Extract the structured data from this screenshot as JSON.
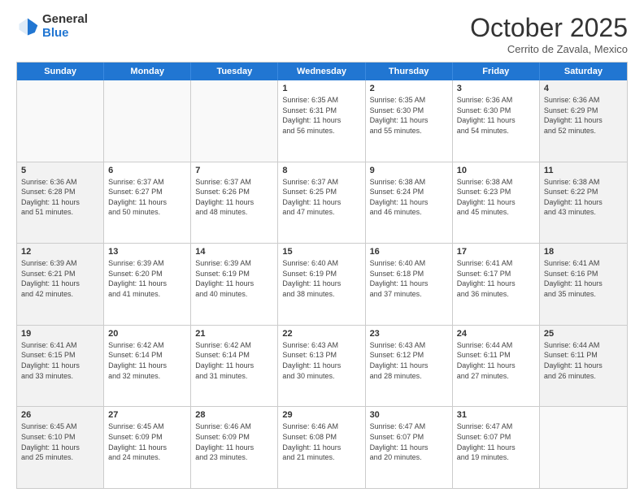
{
  "logo": {
    "general": "General",
    "blue": "Blue"
  },
  "header": {
    "month": "October 2025",
    "location": "Cerrito de Zavala, Mexico"
  },
  "weekdays": [
    "Sunday",
    "Monday",
    "Tuesday",
    "Wednesday",
    "Thursday",
    "Friday",
    "Saturday"
  ],
  "rows": [
    [
      {
        "day": "",
        "info": "",
        "shaded": false
      },
      {
        "day": "",
        "info": "",
        "shaded": false
      },
      {
        "day": "",
        "info": "",
        "shaded": false
      },
      {
        "day": "1",
        "info": "Sunrise: 6:35 AM\nSunset: 6:31 PM\nDaylight: 11 hours\nand 56 minutes.",
        "shaded": false
      },
      {
        "day": "2",
        "info": "Sunrise: 6:35 AM\nSunset: 6:30 PM\nDaylight: 11 hours\nand 55 minutes.",
        "shaded": false
      },
      {
        "day": "3",
        "info": "Sunrise: 6:36 AM\nSunset: 6:30 PM\nDaylight: 11 hours\nand 54 minutes.",
        "shaded": false
      },
      {
        "day": "4",
        "info": "Sunrise: 6:36 AM\nSunset: 6:29 PM\nDaylight: 11 hours\nand 52 minutes.",
        "shaded": true
      }
    ],
    [
      {
        "day": "5",
        "info": "Sunrise: 6:36 AM\nSunset: 6:28 PM\nDaylight: 11 hours\nand 51 minutes.",
        "shaded": true
      },
      {
        "day": "6",
        "info": "Sunrise: 6:37 AM\nSunset: 6:27 PM\nDaylight: 11 hours\nand 50 minutes.",
        "shaded": false
      },
      {
        "day": "7",
        "info": "Sunrise: 6:37 AM\nSunset: 6:26 PM\nDaylight: 11 hours\nand 48 minutes.",
        "shaded": false
      },
      {
        "day": "8",
        "info": "Sunrise: 6:37 AM\nSunset: 6:25 PM\nDaylight: 11 hours\nand 47 minutes.",
        "shaded": false
      },
      {
        "day": "9",
        "info": "Sunrise: 6:38 AM\nSunset: 6:24 PM\nDaylight: 11 hours\nand 46 minutes.",
        "shaded": false
      },
      {
        "day": "10",
        "info": "Sunrise: 6:38 AM\nSunset: 6:23 PM\nDaylight: 11 hours\nand 45 minutes.",
        "shaded": false
      },
      {
        "day": "11",
        "info": "Sunrise: 6:38 AM\nSunset: 6:22 PM\nDaylight: 11 hours\nand 43 minutes.",
        "shaded": true
      }
    ],
    [
      {
        "day": "12",
        "info": "Sunrise: 6:39 AM\nSunset: 6:21 PM\nDaylight: 11 hours\nand 42 minutes.",
        "shaded": true
      },
      {
        "day": "13",
        "info": "Sunrise: 6:39 AM\nSunset: 6:20 PM\nDaylight: 11 hours\nand 41 minutes.",
        "shaded": false
      },
      {
        "day": "14",
        "info": "Sunrise: 6:39 AM\nSunset: 6:19 PM\nDaylight: 11 hours\nand 40 minutes.",
        "shaded": false
      },
      {
        "day": "15",
        "info": "Sunrise: 6:40 AM\nSunset: 6:19 PM\nDaylight: 11 hours\nand 38 minutes.",
        "shaded": false
      },
      {
        "day": "16",
        "info": "Sunrise: 6:40 AM\nSunset: 6:18 PM\nDaylight: 11 hours\nand 37 minutes.",
        "shaded": false
      },
      {
        "day": "17",
        "info": "Sunrise: 6:41 AM\nSunset: 6:17 PM\nDaylight: 11 hours\nand 36 minutes.",
        "shaded": false
      },
      {
        "day": "18",
        "info": "Sunrise: 6:41 AM\nSunset: 6:16 PM\nDaylight: 11 hours\nand 35 minutes.",
        "shaded": true
      }
    ],
    [
      {
        "day": "19",
        "info": "Sunrise: 6:41 AM\nSunset: 6:15 PM\nDaylight: 11 hours\nand 33 minutes.",
        "shaded": true
      },
      {
        "day": "20",
        "info": "Sunrise: 6:42 AM\nSunset: 6:14 PM\nDaylight: 11 hours\nand 32 minutes.",
        "shaded": false
      },
      {
        "day": "21",
        "info": "Sunrise: 6:42 AM\nSunset: 6:14 PM\nDaylight: 11 hours\nand 31 minutes.",
        "shaded": false
      },
      {
        "day": "22",
        "info": "Sunrise: 6:43 AM\nSunset: 6:13 PM\nDaylight: 11 hours\nand 30 minutes.",
        "shaded": false
      },
      {
        "day": "23",
        "info": "Sunrise: 6:43 AM\nSunset: 6:12 PM\nDaylight: 11 hours\nand 28 minutes.",
        "shaded": false
      },
      {
        "day": "24",
        "info": "Sunrise: 6:44 AM\nSunset: 6:11 PM\nDaylight: 11 hours\nand 27 minutes.",
        "shaded": false
      },
      {
        "day": "25",
        "info": "Sunrise: 6:44 AM\nSunset: 6:11 PM\nDaylight: 11 hours\nand 26 minutes.",
        "shaded": true
      }
    ],
    [
      {
        "day": "26",
        "info": "Sunrise: 6:45 AM\nSunset: 6:10 PM\nDaylight: 11 hours\nand 25 minutes.",
        "shaded": true
      },
      {
        "day": "27",
        "info": "Sunrise: 6:45 AM\nSunset: 6:09 PM\nDaylight: 11 hours\nand 24 minutes.",
        "shaded": false
      },
      {
        "day": "28",
        "info": "Sunrise: 6:46 AM\nSunset: 6:09 PM\nDaylight: 11 hours\nand 23 minutes.",
        "shaded": false
      },
      {
        "day": "29",
        "info": "Sunrise: 6:46 AM\nSunset: 6:08 PM\nDaylight: 11 hours\nand 21 minutes.",
        "shaded": false
      },
      {
        "day": "30",
        "info": "Sunrise: 6:47 AM\nSunset: 6:07 PM\nDaylight: 11 hours\nand 20 minutes.",
        "shaded": false
      },
      {
        "day": "31",
        "info": "Sunrise: 6:47 AM\nSunset: 6:07 PM\nDaylight: 11 hours\nand 19 minutes.",
        "shaded": false
      },
      {
        "day": "",
        "info": "",
        "shaded": true
      }
    ]
  ]
}
